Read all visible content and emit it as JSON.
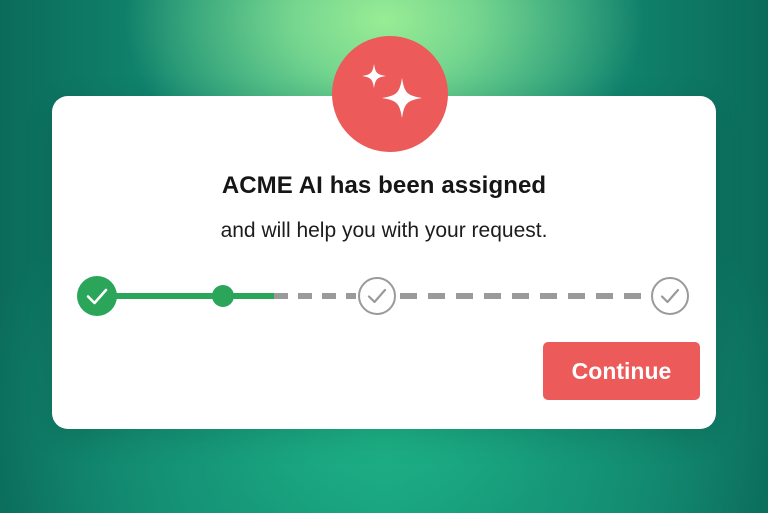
{
  "dialog": {
    "title": "ACME AI has been assigned",
    "subtitle": "and will help you with your request.",
    "icon": "sparkles-icon",
    "continue_label": "Continue"
  },
  "progress": {
    "steps": [
      {
        "state": "completed"
      },
      {
        "state": "current"
      },
      {
        "state": "pending"
      },
      {
        "state": "pending"
      }
    ]
  },
  "colors": {
    "accent_red": "#ec5a5a",
    "progress_green": "#2aa55a",
    "pending_gray": "#9a9a9a"
  }
}
